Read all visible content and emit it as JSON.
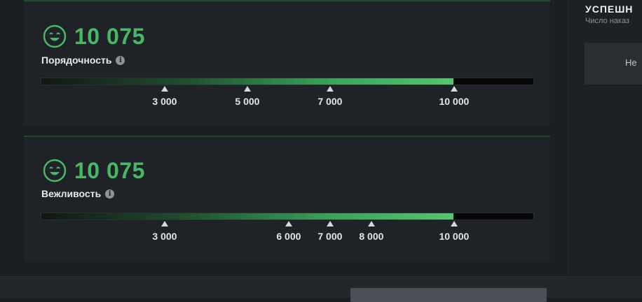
{
  "colors": {
    "accent_green": "#48b864",
    "track": "#070707",
    "panel": "#1f2327"
  },
  "behavior": {
    "score": "10 075",
    "label": "Порядочность",
    "icon": "smiley-icon",
    "fill_fraction": 0.838,
    "ticks": [
      {
        "label": "3 000",
        "value": 3000
      },
      {
        "label": "5 000",
        "value": 5000
      },
      {
        "label": "7 000",
        "value": 7000
      },
      {
        "label": "10 000",
        "value": 10000
      }
    ]
  },
  "politeness": {
    "score": "10 075",
    "label": "Вежливость",
    "icon": "smiley-icon",
    "fill_fraction": 0.838,
    "ticks": [
      {
        "label": "3 000",
        "value": 3000
      },
      {
        "label": "6 000",
        "value": 6000
      },
      {
        "label": "7 000",
        "value": 7000
      },
      {
        "label": "8 000",
        "value": 8000
      },
      {
        "label": "10 000",
        "value": 10000
      }
    ]
  },
  "right_panel": {
    "title": "УСПЕШН",
    "subtitle": "Число наказ",
    "box_text": "Не"
  }
}
